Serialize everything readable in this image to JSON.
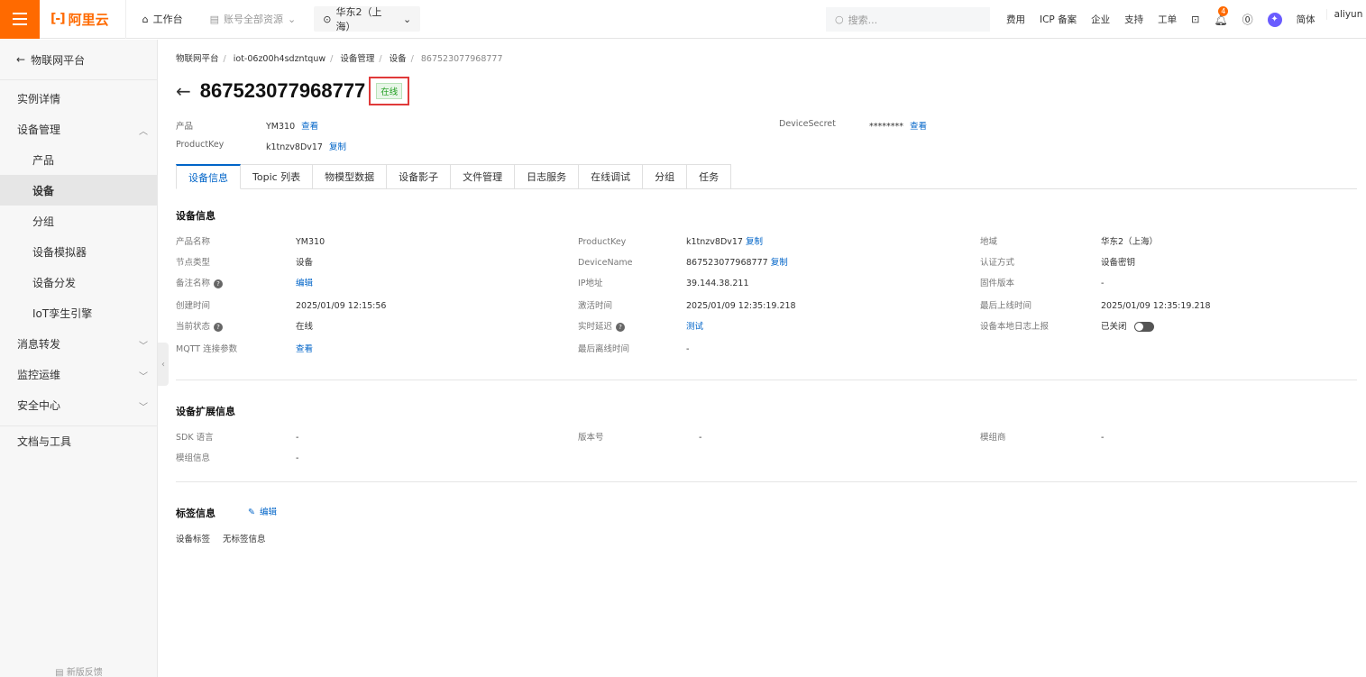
{
  "topbar": {
    "logo": "阿里云",
    "workbench": "工作台",
    "account_resources": "账号全部资源",
    "region": "华东2（上海）",
    "search_placeholder": "搜索...",
    "right_items": [
      "费用",
      "ICP 备案",
      "企业",
      "支持",
      "工单"
    ],
    "notification_count": "4",
    "lang": "简体",
    "user": "aliyun"
  },
  "sidebar": {
    "back_label": "物联网平台",
    "items": [
      {
        "label": "实例详情"
      },
      {
        "label": "设备管理"
      },
      {
        "label": "产品"
      },
      {
        "label": "设备"
      },
      {
        "label": "分组"
      },
      {
        "label": "设备模拟器"
      },
      {
        "label": "设备分发"
      },
      {
        "label": "IoT孪生引擎"
      },
      {
        "label": "消息转发"
      },
      {
        "label": "监控运维"
      },
      {
        "label": "安全中心"
      },
      {
        "label": "文档与工具"
      }
    ],
    "footer": "新版反馈"
  },
  "breadcrumb": [
    "物联网平台",
    "iot-06z00h4sdzntquw",
    "设备管理",
    "设备",
    "867523077968777"
  ],
  "header": {
    "title": "867523077968777",
    "status": "在线",
    "product_label": "产品",
    "product_value": "YM310",
    "product_link": "查看",
    "productkey_label": "ProductKey",
    "productkey_value": "k1tnzv8Dv17",
    "productkey_link": "复制",
    "secret_label": "DeviceSecret",
    "secret_value": "********",
    "secret_link": "查看"
  },
  "tabs": [
    "设备信息",
    "Topic 列表",
    "物模型数据",
    "设备影子",
    "文件管理",
    "日志服务",
    "在线调试",
    "分组",
    "任务"
  ],
  "device_info": {
    "title": "设备信息",
    "col1": [
      {
        "label": "产品名称",
        "value": "YM310"
      },
      {
        "label": "节点类型",
        "value": "设备"
      },
      {
        "label": "备注名称",
        "value": "编辑"
      },
      {
        "label": "创建时间",
        "value": "2025/01/09 12:15:56"
      },
      {
        "label": "当前状态",
        "value": "在线"
      },
      {
        "label": "MQTT 连接参数",
        "value": "查看"
      }
    ],
    "col2": [
      {
        "label": "ProductKey",
        "value": "k1tnzv8Dv17",
        "link": "复制"
      },
      {
        "label": "DeviceName",
        "value": "867523077968777",
        "link": "复制"
      },
      {
        "label": "IP地址",
        "value": "39.144.38.211"
      },
      {
        "label": "激活时间",
        "value": "2025/01/09 12:35:19.218"
      },
      {
        "label": "实时延迟",
        "value": "测试"
      },
      {
        "label": "最后离线时间",
        "value": "-"
      }
    ],
    "col3": [
      {
        "label": "地域",
        "value": "华东2（上海）"
      },
      {
        "label": "认证方式",
        "value": "设备密钥"
      },
      {
        "label": "固件版本",
        "value": "-"
      },
      {
        "label": "最后上线时间",
        "value": "2025/01/09 12:35:19.218"
      },
      {
        "label": "设备本地日志上报",
        "value": "已关闭"
      }
    ]
  },
  "ext_info": {
    "title": "设备扩展信息",
    "rows": [
      {
        "label": "SDK 语言",
        "value": "-"
      },
      {
        "label": "版本号",
        "value": "-"
      },
      {
        "label": "模组商",
        "value": "-"
      },
      {
        "label": "模组信息",
        "value": "-"
      }
    ]
  },
  "tags": {
    "title": "标签信息",
    "edit": "编辑",
    "label": "设备标签",
    "value": "无标签信息"
  }
}
